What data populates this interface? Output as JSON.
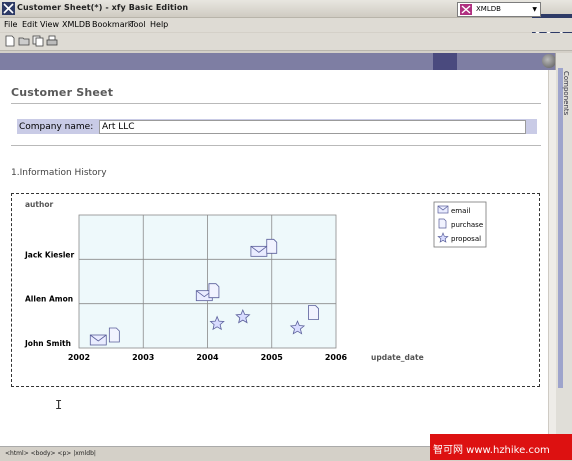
{
  "window": {
    "title": "Customer Sheet(*) - xfy Basic Edition"
  },
  "menu": [
    "File",
    "Edit",
    "View",
    "XMLDB",
    "Bookmark",
    "Tool",
    "Help"
  ],
  "toolbar": {
    "icons": [
      "new-doc-icon",
      "open-folder-icon",
      "copy-icon",
      "print-icon"
    ]
  },
  "component_select": {
    "value": "XMLDB"
  },
  "side_panel": {
    "label": "Components"
  },
  "document": {
    "heading": "Customer Sheet",
    "company_label": "Company name:",
    "company_value": "Art LLC",
    "section_title": "1.Information History"
  },
  "chart_data": {
    "type": "scatter",
    "ylabel": "author",
    "xlabel": "update_date",
    "x_ticks": [
      "2002",
      "2003",
      "2004",
      "2005",
      "2006"
    ],
    "y_categories": [
      "John Smith",
      "Allen Amon",
      "Jack Kiesler"
    ],
    "legend": [
      {
        "name": "email",
        "icon": "envelope"
      },
      {
        "name": "purchase",
        "icon": "document"
      },
      {
        "name": "proposal",
        "icon": "star"
      }
    ],
    "legend_position": "top-right",
    "grid": true,
    "plot_bg": "#eef9fb",
    "points": [
      {
        "x": 2002.3,
        "y": "John Smith",
        "series": "email"
      },
      {
        "x": 2002.55,
        "y": "John Smith",
        "series": "purchase"
      },
      {
        "x": 2003.95,
        "y": "Allen Amon",
        "series": "email"
      },
      {
        "x": 2004.1,
        "y": "Allen Amon",
        "series": "purchase"
      },
      {
        "x": 2004.8,
        "y": "Jack Kiesler",
        "series": "email"
      },
      {
        "x": 2005.0,
        "y": "Jack Kiesler",
        "series": "purchase"
      },
      {
        "x": 2004.15,
        "y": "John Smith",
        "series": "proposal",
        "offset": 0.55
      },
      {
        "x": 2004.55,
        "y": "John Smith",
        "series": "proposal",
        "offset": 0.7
      },
      {
        "x": 2005.4,
        "y": "John Smith",
        "series": "proposal",
        "offset": 0.45
      },
      {
        "x": 2005.65,
        "y": "John Smith",
        "series": "purchase",
        "offset": 0.8
      }
    ]
  },
  "status": {
    "path": "<html> <body> <p> |xmldb|"
  },
  "watermark": {
    "text": "智可网 www.hzhike.com"
  },
  "colors": {
    "compbar": "#7e7ea3",
    "company_row": "#c9cbe6",
    "brand": "#2d3a66"
  }
}
